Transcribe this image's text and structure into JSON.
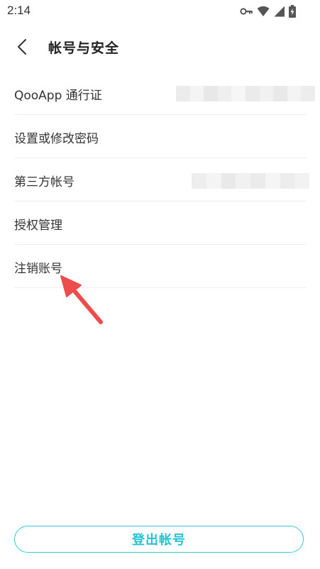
{
  "status_bar": {
    "time": "2:14",
    "icons": [
      "key-icon",
      "wifi-icon",
      "signal-icon",
      "battery-charging-icon"
    ]
  },
  "header": {
    "title": "帐号与安全",
    "back_icon": "chevron-left-icon"
  },
  "settings": {
    "items": [
      {
        "label": "QooApp 通行证",
        "value_redacted": true
      },
      {
        "label": "设置或修改密码"
      },
      {
        "label": "第三方帐号",
        "value_redacted": true
      },
      {
        "label": "授权管理"
      },
      {
        "label": "注销账号"
      }
    ]
  },
  "annotation": {
    "arrow_color": "#ee4b4b",
    "points_to": "注销账号"
  },
  "logout": {
    "label": "登出帐号",
    "accent_color": "#25c3d3"
  }
}
